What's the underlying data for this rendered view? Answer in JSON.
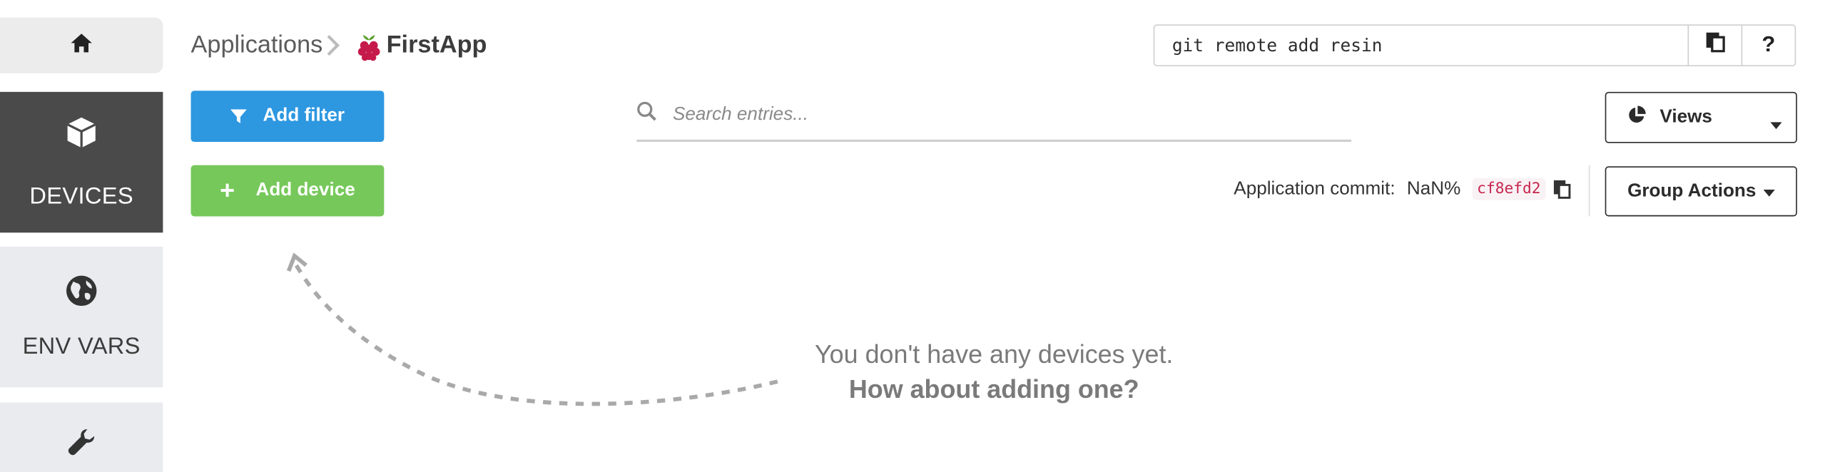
{
  "sidebar": {
    "items": [
      {
        "icon": "home-icon",
        "label": ""
      },
      {
        "icon": "cube-icon",
        "label": "DEVICES"
      },
      {
        "icon": "globe-icon",
        "label": "ENV VARS"
      },
      {
        "icon": "wrench-icon",
        "label": ""
      }
    ]
  },
  "breadcrumb": {
    "root": "Applications",
    "app": "FirstApp",
    "app_icon": "raspberry-pi-icon"
  },
  "git": {
    "command": "git remote add resin",
    "help_label": "?"
  },
  "toolbar": {
    "add_filter_label": "Add filter",
    "add_device_label": "Add device",
    "views_label": "Views",
    "group_actions_label": "Group Actions"
  },
  "search": {
    "placeholder": "Search entries...",
    "value": ""
  },
  "commit": {
    "label": "Application commit:",
    "percent": "NaN%",
    "hash": "cf8efd2"
  },
  "empty_state": {
    "line1": "You don't have any devices yet.",
    "line2": "How about adding one?"
  },
  "colors": {
    "accent_blue": "#2d97e0",
    "accent_green": "#76c85a",
    "sidebar_active": "#4a4a4a",
    "sidebar_bg": "#e9ebef",
    "commit_hash": "#c7254e"
  }
}
